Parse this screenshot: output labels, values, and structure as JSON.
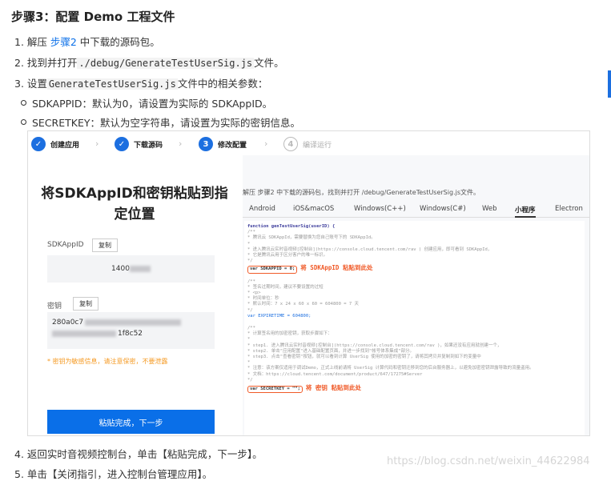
{
  "title": "步骤3：配置 Demo 工程文件",
  "steps": {
    "s1_pre": "1. 解压 ",
    "s1_link": "步骤2",
    "s1_post": " 中下载的源码包。",
    "s2_pre": "2. 找到并打开",
    "s2_code": "./debug/GenerateTestUserSig.js",
    "s2_post": "文件。",
    "s3_pre": "3. 设置",
    "s3_code": "GenerateTestUserSig.js",
    "s3_post": "文件中的相关参数：",
    "b1": "SDKAPPID：默认为0，请设置为实际的 SDKAppID。",
    "b2": "SECRETKEY：默认为空字符串，请设置为实际的密钥信息。",
    "s4": "4. 返回实时音视频控制台，单击【粘贴完成，下一步】。",
    "s5": "5. 单击【关闭指引，进入控制台管理应用】。"
  },
  "wizard": {
    "step1": {
      "num": "✓",
      "label": "创建应用"
    },
    "step2": {
      "num": "✓",
      "label": "下载源码"
    },
    "step3": {
      "num": "3",
      "label": "修改配置"
    },
    "step4": {
      "num": "4",
      "label": "编译运行"
    }
  },
  "left": {
    "heading": "将SDKAppID和密钥粘贴到指定位置",
    "sdkappid_label": "SDKAppID",
    "copy_label": "复制",
    "sdkappid_value": "1400",
    "key_label": "密钥",
    "key_line1": "280a0c7",
    "key_line2": "1f8c52",
    "warning": "* 密钥为敏感信息，请注意保密，不要泄露",
    "paste_button": "粘贴完成，下一步"
  },
  "right": {
    "desc": "解压 步骤2 中下载的源码包，找到并打开 /debug/GenerateTestUserSig.js文件。",
    "tabs": [
      "Android",
      "iOS&macOS",
      "Windows(C++)",
      "Windows(C#)",
      "Web",
      "小程序",
      "Electron"
    ],
    "active_tab": "小程序",
    "code": {
      "fn": "function genTestUserSig(userID) {",
      "c1": "/**",
      "c2": " * 腾讯云 SDKAppId，需要替换为您自己账号下的 SDKAppId。",
      "c3": " *",
      "c4": " * 进入腾讯云实时音视频[控制台](https://console.cloud.tencent.com/rav ) 创建应用，即可看到 SDKAppId，",
      "c5": " * 它是腾讯云用于区分客户的唯一标识。",
      "c6": " */",
      "sdk_line": "var SDKAPPID = 0;",
      "sdk_anno": "将 SDKAppID 粘贴到此处",
      "c7": "/**",
      "c8": " * 签名过期时间，建议不要设置的过短",
      "c9": " * <p>",
      "c10": " * 时间单位：秒",
      "c11": " * 默认时间：7 x 24 x 60 x 60 = 604800 = 7 天",
      "c12": " */",
      "exp_line": "var EXPIRETIME = 604800;",
      "c13": "/**",
      "c14": " * 计算签名用的加密密钥，获取步骤如下：",
      "c15": " *",
      "c16": " * step1. 进入腾讯云实时音视频[控制台](https://console.cloud.tencent.com/rav )，如果还没有应用就创建一个，",
      "c17": " * step2. 单击\"应用配置\"进入基础配置页面，并进一步找到\"帐号体系集成\"部分。",
      "c18": " * step3. 点击\"查看密钥\"按钮，就可以看到计算 UserSig 使用的加密的密钥了，请将其拷贝并复制到如下的变量中",
      "c19": " *",
      "c20": " * 注意：该方案仅适用于调试Demo，正式上线前请将 UserSig 计算代码和密钥迁移到您的后台服务器上，以避免加密密钥泄露导致的流量盗用。",
      "c21": " * 文档：https://cloud.tencent.com/document/product/647/17275#Server",
      "c22": " */",
      "secret_line": "var SECRETKEY = \"\";",
      "secret_anno": "将 密钥 粘贴到此处"
    }
  },
  "watermark": "https://blog.csdn.net/weixin_44622984",
  "colors": {
    "accent": "#1c6fe0",
    "link": "#0a6fe8",
    "warning": "#f59a23",
    "highlight": "#f05a28"
  }
}
